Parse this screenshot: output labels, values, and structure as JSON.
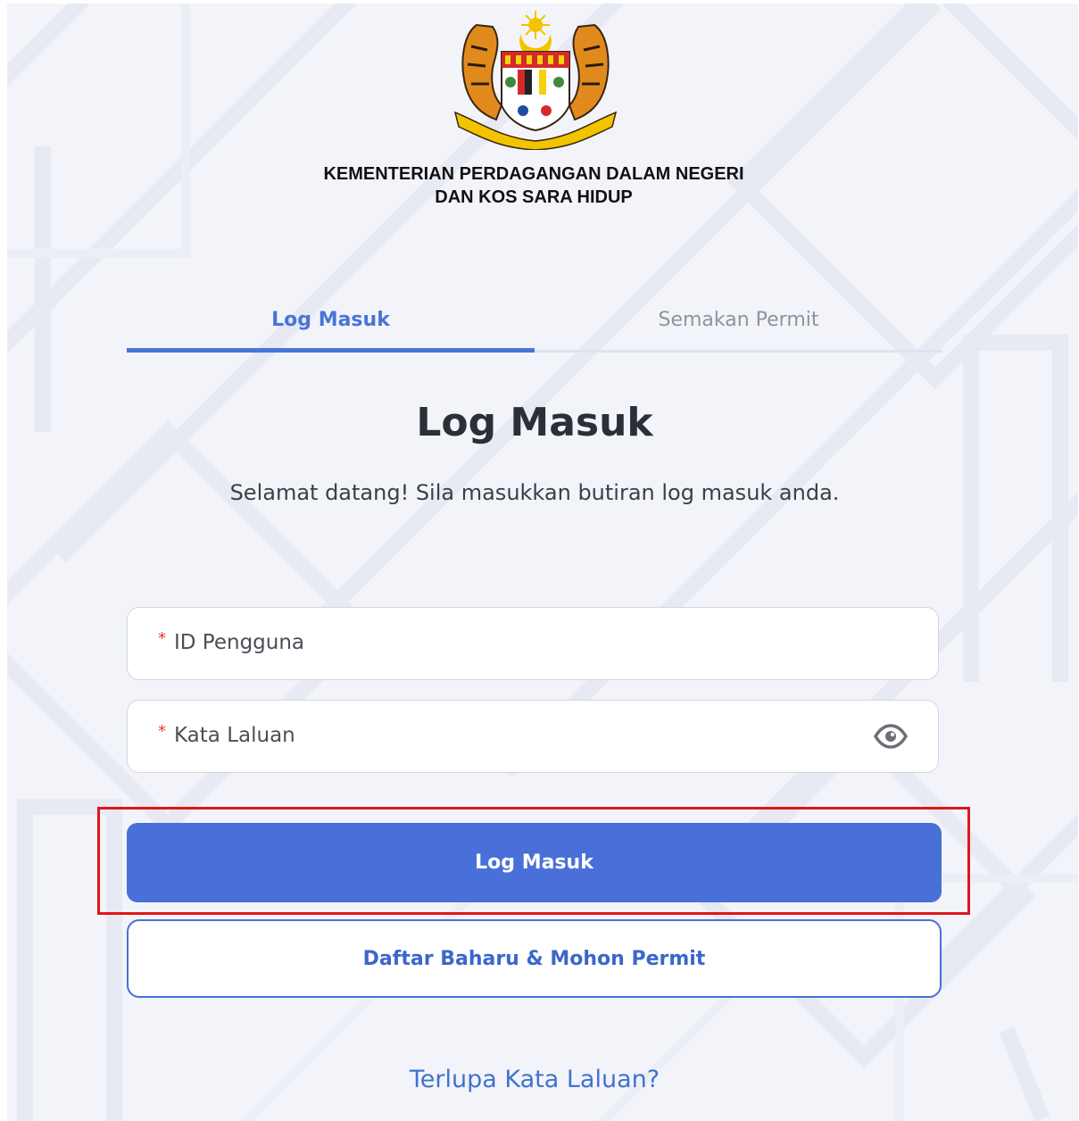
{
  "header": {
    "ministry_line1": "KEMENTERIAN PERDAGANGAN DALAM NEGERI",
    "ministry_line2": "DAN KOS SARA HIDUP",
    "crest_icon": "malaysia-coat-of-arms-icon"
  },
  "tabs": [
    {
      "label": "Log Masuk",
      "active": true
    },
    {
      "label": "Semakan Permit",
      "active": false
    }
  ],
  "form": {
    "heading": "Log Masuk",
    "subtitle": "Selamat datang! Sila masukkan butiran log masuk anda.",
    "username": {
      "label": "ID Pengguna",
      "required_mark": "*",
      "value": ""
    },
    "password": {
      "label": "Kata Laluan",
      "required_mark": "*",
      "value": "",
      "toggle_icon": "eye-icon"
    },
    "login_button": "Log Masuk",
    "register_button": "Daftar Baharu & Mohon Permit",
    "forgot_link": "Terlupa Kata Laluan?"
  },
  "colors": {
    "accent": "#4870d8",
    "highlight": "#e0161a",
    "required": "#e53935",
    "background": "#f3f4fa"
  }
}
